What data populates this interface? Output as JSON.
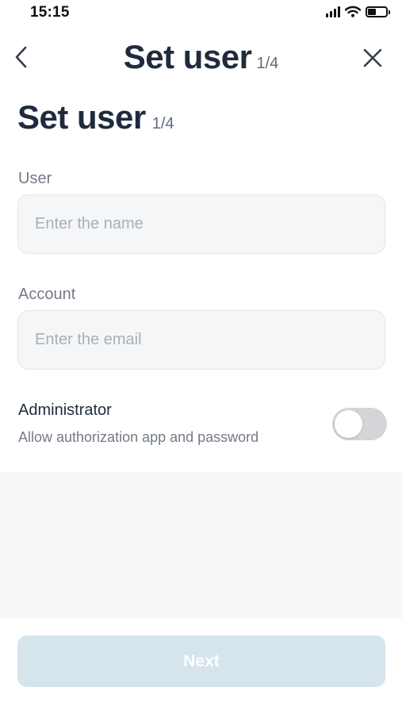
{
  "status_bar": {
    "time": "15:15",
    "icons": [
      "signal-icon",
      "wifi-icon",
      "battery-icon"
    ],
    "battery_level": 0.45
  },
  "nav": {
    "title": "Set user",
    "step": "1/4",
    "back_icon": "chevron-left-icon",
    "close_icon": "close-icon"
  },
  "heading": {
    "title": "Set user",
    "step": "1/4"
  },
  "form": {
    "user": {
      "label": "User",
      "placeholder": "Enter the name",
      "value": ""
    },
    "account": {
      "label": "Account",
      "placeholder": "Enter the email",
      "value": ""
    }
  },
  "admin": {
    "title": "Administrator",
    "description": "Allow authorization app and password",
    "enabled": false
  },
  "footer": {
    "next_label": "Next"
  },
  "colors": {
    "title_text": "#1f2b3d",
    "label_text": "#737b86",
    "input_bg": "#f5f6f7",
    "toggle_off": "#d3d5d8",
    "next_button_disabled": "#d6e4ec"
  }
}
